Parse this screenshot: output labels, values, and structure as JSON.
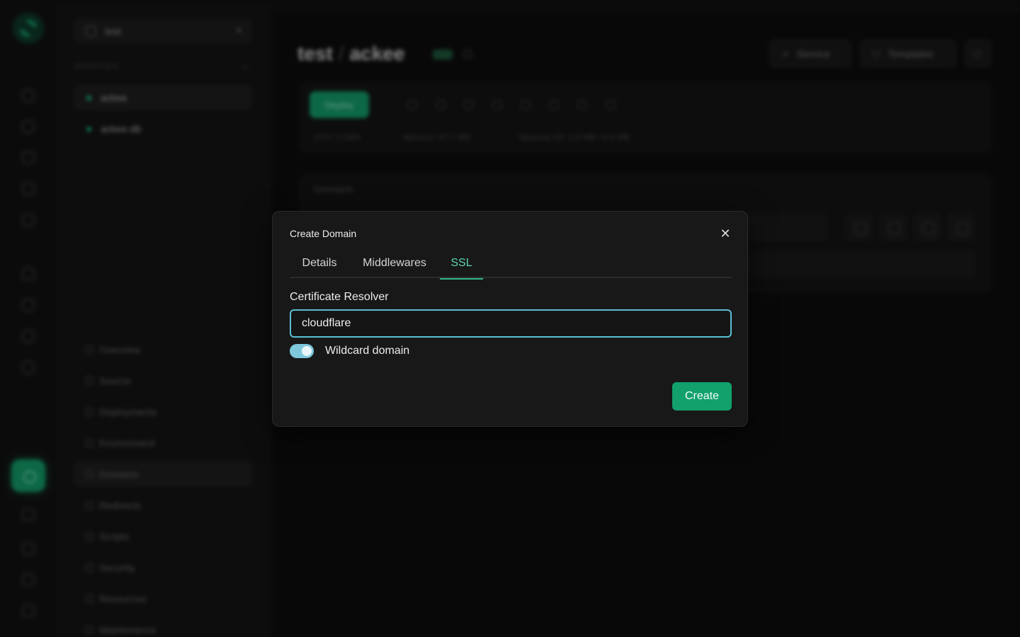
{
  "app": {
    "project": "test",
    "breadcrumb": [
      "test",
      "ackee"
    ],
    "services_label": "SERVICES",
    "services": [
      {
        "name": "ackee",
        "selected": true
      },
      {
        "name": "ackee-db",
        "selected": false
      }
    ],
    "nav": [
      "Overview",
      "Source",
      "Deployments",
      "Environment",
      "Domains",
      "Redirects",
      "Scripts",
      "Security",
      "Resources",
      "Maintenance"
    ],
    "active_nav": "Domains",
    "header_buttons": [
      "Service",
      "Templates"
    ],
    "deploy_label": "Deploy",
    "stats": [
      "CPU: 0.26%",
      "Memory: 97.7 MB",
      "Network I/O: 1.8 MB / 6.4 MB"
    ],
    "domains_card_title": "Domains"
  },
  "dialog": {
    "title": "Create Domain",
    "tabs": [
      {
        "label": "Details",
        "active": false
      },
      {
        "label": "Middlewares",
        "active": false
      },
      {
        "label": "SSL",
        "active": true
      }
    ],
    "certificate_resolver": {
      "label": "Certificate Resolver",
      "value": "cloudflare"
    },
    "wildcard": {
      "label": "Wildcard domain",
      "enabled": true
    },
    "create_label": "Create",
    "close_icon": "close-icon"
  },
  "colors": {
    "accent": "#12a06c",
    "tab_active": "#5fd3b4",
    "input_focus": "#5bbfd6",
    "switch_on": "#7fc8dc"
  }
}
